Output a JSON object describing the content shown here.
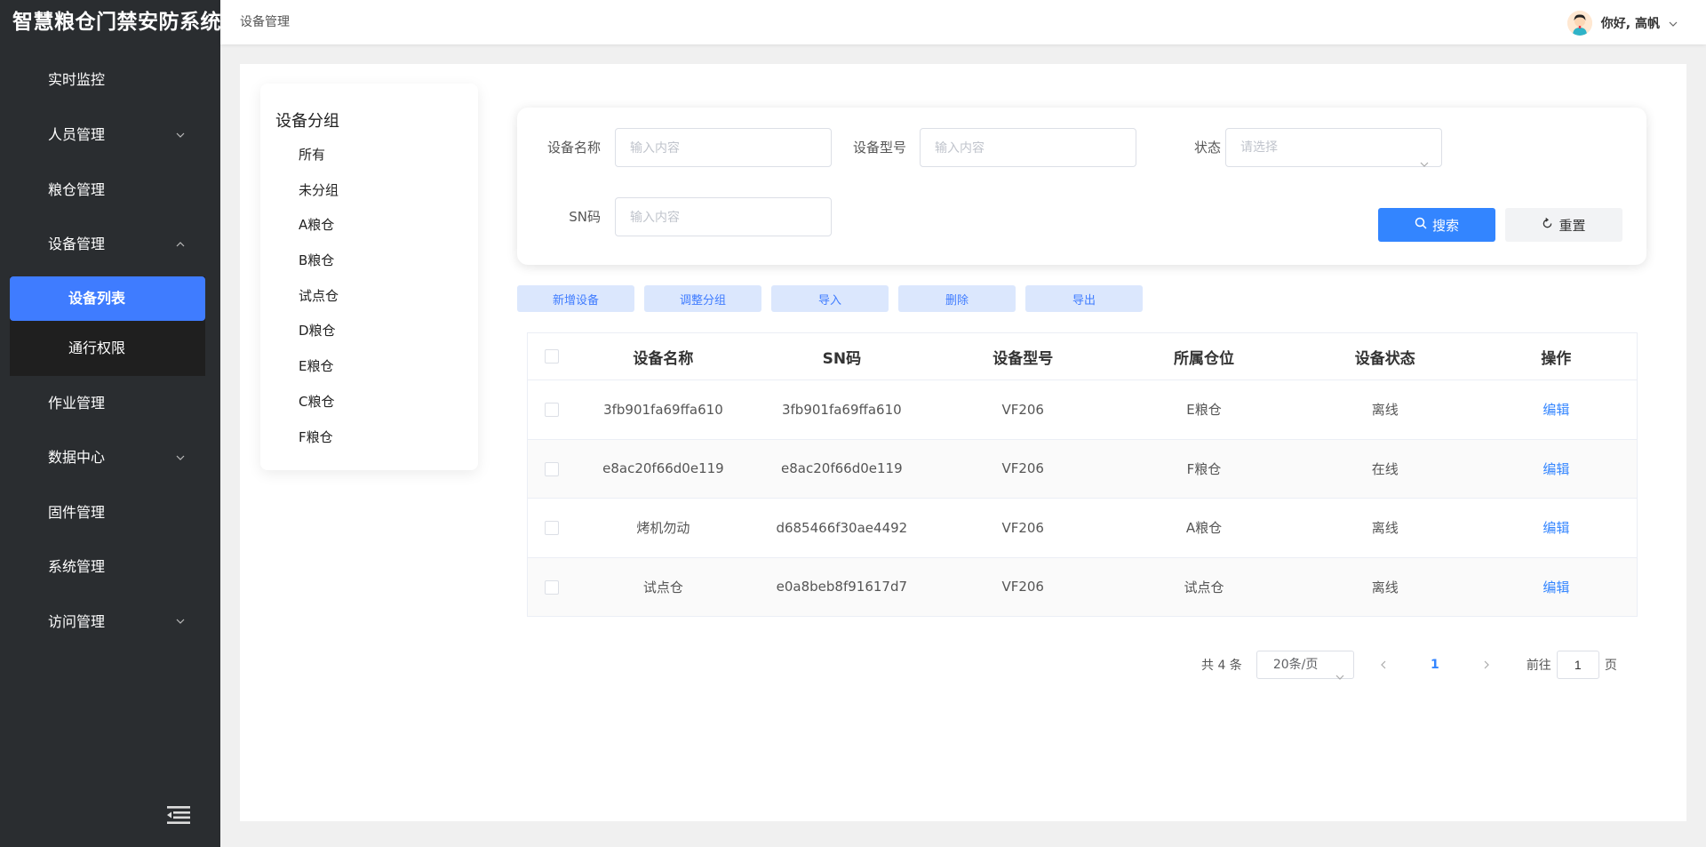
{
  "app": {
    "title": "智慧粮仓门禁安防系统"
  },
  "sidebar": {
    "items": [
      {
        "label": "实时监控",
        "expandable": false
      },
      {
        "label": "人员管理",
        "expandable": true
      },
      {
        "label": "粮仓管理",
        "expandable": false
      },
      {
        "label": "设备管理",
        "expandable": true,
        "expanded": true
      },
      {
        "label": "作业管理",
        "expandable": false
      },
      {
        "label": "数据中心",
        "expandable": true
      },
      {
        "label": "固件管理",
        "expandable": false
      },
      {
        "label": "系统管理",
        "expandable": false
      },
      {
        "label": "访问管理",
        "expandable": true
      }
    ],
    "sub_items": [
      {
        "label": "设备列表",
        "active": true
      },
      {
        "label": "通行权限",
        "active": false
      }
    ]
  },
  "header": {
    "breadcrumb": "设备管理",
    "greeting": "你好, 高帆"
  },
  "groups": {
    "title": "设备分组",
    "items": [
      "所有",
      "未分组",
      "A粮仓",
      "B粮仓",
      "试点仓",
      "D粮仓",
      "E粮仓",
      "C粮仓",
      "F粮仓"
    ]
  },
  "search": {
    "name_label": "设备名称",
    "name_placeholder": "输入内容",
    "model_label": "设备型号",
    "model_placeholder": "输入内容",
    "status_label": "状态",
    "status_placeholder": "请选择",
    "sn_label": "SN码",
    "sn_placeholder": "输入内容",
    "search_button": "搜索",
    "reset_button": "重置"
  },
  "toolbar": {
    "add": "新增设备",
    "adjust": "调整分组",
    "import": "导入",
    "delete": "删除",
    "export": "导出"
  },
  "table": {
    "headers": [
      "设备名称",
      "SN码",
      "设备型号",
      "所属仓位",
      "设备状态",
      "操作"
    ],
    "rows": [
      {
        "name": "3fb901fa69ffa610",
        "sn": "3fb901fa69ffa610",
        "model": "VF206",
        "location": "E粮仓",
        "status": "离线",
        "action": "编辑"
      },
      {
        "name": "e8ac20f66d0e119",
        "sn": "e8ac20f66d0e119",
        "model": "VF206",
        "location": "F粮仓",
        "status": "在线",
        "action": "编辑"
      },
      {
        "name": "烤机勿动",
        "sn": "d685466f30ae4492",
        "model": "VF206",
        "location": "A粮仓",
        "status": "离线",
        "action": "编辑"
      },
      {
        "name": "试点仓",
        "sn": "e0a8beb8f91617d7",
        "model": "VF206",
        "location": "试点仓",
        "status": "离线",
        "action": "编辑"
      }
    ]
  },
  "pagination": {
    "total": "共 4 条",
    "page_size": "20条/页",
    "current_page": "1",
    "goto_label": "前往",
    "goto_value": "1",
    "page_suffix": "页"
  },
  "colors": {
    "sidebar_bg": "#2a2d30",
    "accent": "#3f7cff",
    "offline": "#e0243a",
    "online": "#52c41a"
  }
}
